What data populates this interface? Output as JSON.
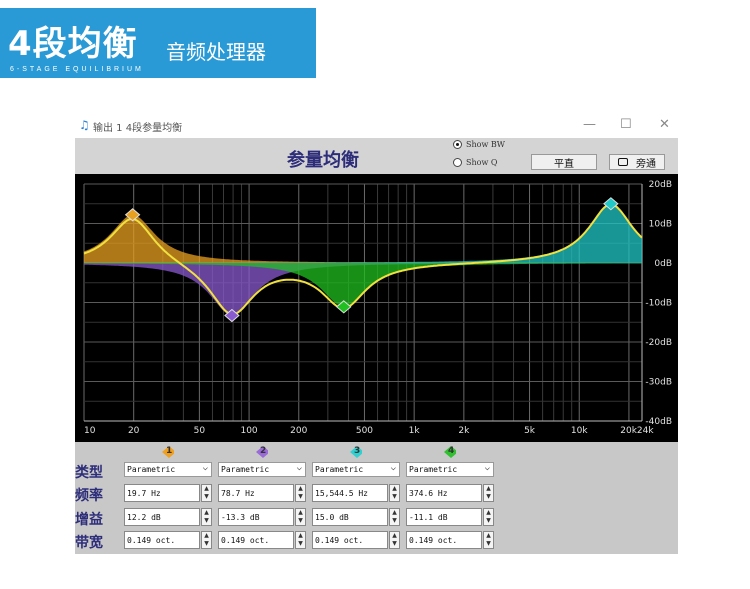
{
  "banner": {
    "title_big": "4段均衡",
    "title_small": "音频处理器",
    "subtitle": "6-STAGE EQUILIBRIUM"
  },
  "window": {
    "title": "输出 1  4段参量均衡",
    "min_glyph": "—",
    "max_glyph": "☐",
    "close_glyph": "✕",
    "header_title": "参量均衡",
    "radio_show_bw": "Show BW",
    "radio_show_q": "Show Q",
    "flat_button": "平直",
    "bypass_button": "旁通"
  },
  "chart_data": {
    "type": "line",
    "x_scale": "log",
    "xlim": [
      10,
      24000
    ],
    "ylim": [
      -40,
      20
    ],
    "x_ticks": [
      "10",
      "20",
      "50",
      "100",
      "200",
      "500",
      "1k",
      "2k",
      "5k",
      "10k",
      "20k24k"
    ],
    "y_ticks": [
      "20dB",
      "10dB",
      "0dB",
      "-10dB",
      "-20dB",
      "-30dB",
      "-40dB"
    ],
    "grid": true,
    "bands": [
      {
        "id": "1",
        "freq": 19.7,
        "gain": 12.2,
        "bw": 0.149,
        "color": "#e8a020"
      },
      {
        "id": "2",
        "freq": 78.7,
        "gain": -13.3,
        "bw": 0.149,
        "color": "#8a5ad0"
      },
      {
        "id": "3",
        "freq": 15544.5,
        "gain": 15.0,
        "bw": 0.149,
        "color": "#20c8c8"
      },
      {
        "id": "4",
        "freq": 374.6,
        "gain": -11.1,
        "bw": 0.149,
        "color": "#20c020"
      }
    ],
    "curve_color": "#f0e040"
  },
  "controls": {
    "row_labels": [
      "类型",
      "频率",
      "增益",
      "带宽"
    ],
    "channels": [
      {
        "num": "1",
        "type": "Parametric",
        "freq": "19.7 Hz",
        "gain": "12.2 dB",
        "bw": "0.149 oct.",
        "color": "#f0a020"
      },
      {
        "num": "2",
        "type": "Parametric",
        "freq": "78.7 Hz",
        "gain": "-13.3 dB",
        "bw": "0.149 oct.",
        "color": "#9a6ad8"
      },
      {
        "num": "3",
        "type": "Parametric",
        "freq": "15,544.5 Hz",
        "gain": "15.0 dB",
        "bw": "0.149 oct.",
        "color": "#30d0d0"
      },
      {
        "num": "4",
        "type": "Parametric",
        "freq": "374.6 Hz",
        "gain": "-11.1 dB",
        "bw": "0.149 oct.",
        "color": "#30c030"
      }
    ]
  }
}
